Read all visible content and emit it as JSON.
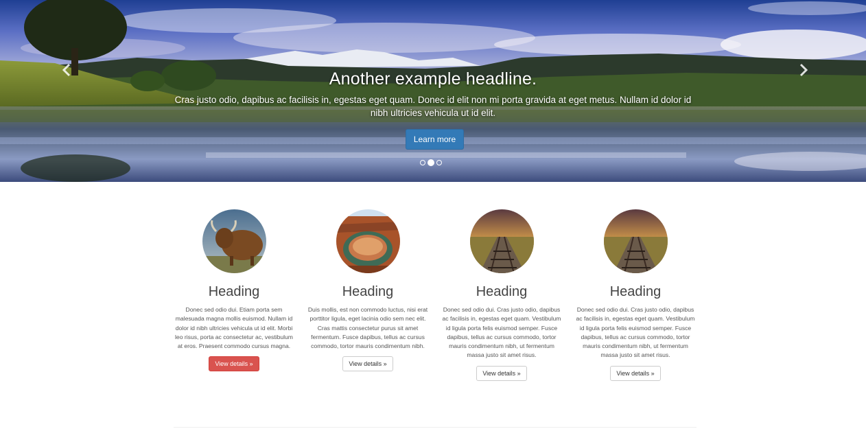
{
  "carousel": {
    "headline": "Another example headline.",
    "text": "Cras justo odio, dapibus ac facilisis in, egestas eget quam. Donec id elit non mi porta gravida at eget metus. Nullam id dolor id nibh ultricies vehicula ut id elit.",
    "button_label": "Learn more",
    "prev_icon": "chevron-left-icon",
    "next_icon": "chevron-right-icon",
    "active_slide": 2,
    "slide_count": 3,
    "button_color": "#337ab7"
  },
  "features": [
    {
      "image": "highland-cow-photo",
      "heading": "Heading",
      "text": "Donec sed odio dui. Etiam porta sem malesuada magna mollis euismod. Nullam id dolor id nibh ultricies vehicula ut id elit. Morbi leo risus, porta ac consectetur ac, vestibulum at eros. Praesent commodo cursus magna.",
      "button_label": "View details »",
      "button_color": "#d9534f"
    },
    {
      "image": "canyon-bend-photo",
      "heading": "Heading",
      "text": "Duis mollis, est non commodo luctus, nisi erat porttitor ligula, eget lacinia odio sem nec elit. Cras mattis consectetur purus sit amet fermentum. Fusce dapibus, tellus ac cursus commodo, tortor mauris condimentum nibh.",
      "button_label": "View details »",
      "button_color": "#ffffff"
    },
    {
      "image": "railway-tracks-photo",
      "heading": "Heading",
      "text": "Donec sed odio dui. Cras justo odio, dapibus ac facilisis in, egestas eget quam. Vestibulum id ligula porta felis euismod semper. Fusce dapibus, tellus ac cursus commodo, tortor mauris condimentum nibh, ut fermentum massa justo sit amet risus.",
      "button_label": "View details »",
      "button_color": "#ffffff"
    },
    {
      "image": "railway-tracks-photo",
      "heading": "Heading",
      "text": "Donec sed odio dui. Cras justo odio, dapibus ac facilisis in, egestas eget quam. Vestibulum id ligula porta felis euismod semper. Fusce dapibus, tellus ac cursus commodo, tortor mauris condimentum nibh, ut fermentum massa justo sit amet risus.",
      "button_label": "View details »",
      "button_color": "#ffffff"
    }
  ]
}
